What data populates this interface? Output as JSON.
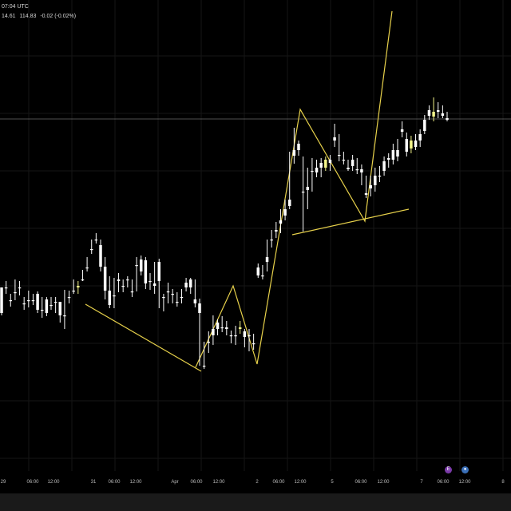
{
  "header": {
    "time_label": "07:04 UTC",
    "ohlc_fields": [
      "14.61",
      "114.83",
      "-0.02 (-0.02%)"
    ]
  },
  "badges": [
    {
      "name": "event-icon",
      "glyph": "E",
      "color": "#7a3aa8"
    },
    {
      "name": "flag-icon",
      "glyph": "●",
      "color": "#3a6fb8"
    }
  ],
  "colors": {
    "background": "#000000",
    "grid": "#161616",
    "candle_up": "#f3f58a",
    "candle_down": "#ffffff",
    "pattern_lines": "#e7d14b",
    "price_line": "#6c6c6c",
    "tick_text": "#bdbdbd"
  },
  "chart_data": {
    "type": "candlestick",
    "x_axis": {
      "tick_labels": [
        "29",
        "06:00",
        "12:00",
        "31",
        "06:00",
        "12:00",
        "Apr",
        "06:00",
        "12:00",
        "2",
        "06:00",
        "12:00",
        "5",
        "06:00",
        "12:00",
        "7",
        "06:00",
        "12:00",
        "8"
      ]
    },
    "grid": true,
    "price_line": 149,
    "candles": [
      [
        360,
        360,
        392,
        395
      ],
      [
        360,
        352,
        360,
        368
      ],
      [
        376,
        368,
        376,
        384
      ],
      [
        366,
        350,
        366,
        376
      ],
      [
        360,
        352,
        360,
        370
      ],
      [
        380,
        372,
        380,
        388
      ],
      [
        376,
        364,
        376,
        385
      ],
      [
        376,
        368,
        376,
        382
      ],
      [
        368,
        365,
        388,
        392
      ],
      [
        388,
        372,
        388,
        398
      ],
      [
        375,
        372,
        392,
        396
      ],
      [
        382,
        372,
        382,
        388
      ],
      [
        378,
        372,
        378,
        392
      ],
      [
        378,
        378,
        395,
        404
      ],
      [
        395,
        363,
        395,
        412
      ],
      [
        372,
        364,
        372,
        380
      ],
      [
        364,
        350,
        364,
        368
      ],
      [
        360,
        352,
        358,
        368
      ],
      [
        350,
        338,
        350,
        352
      ],
      [
        335,
        322,
        335,
        340
      ],
      [
        312,
        300,
        312,
        318
      ],
      [
        300,
        292,
        300,
        305
      ],
      [
        307,
        300,
        334,
        340
      ],
      [
        334,
        322,
        364,
        375
      ],
      [
        364,
        346,
        382,
        386
      ],
      [
        370,
        348,
        370,
        386
      ],
      [
        350,
        342,
        352,
        366
      ],
      [
        358,
        350,
        358,
        366
      ],
      [
        350,
        346,
        350,
        360
      ],
      [
        365,
        350,
        365,
        372
      ],
      [
        332,
        322,
        332,
        365
      ],
      [
        325,
        320,
        340,
        345
      ],
      [
        326,
        322,
        355,
        362
      ],
      [
        352,
        342,
        352,
        363
      ],
      [
        355,
        328,
        358,
        368
      ],
      [
        328,
        324,
        352,
        386
      ],
      [
        372,
        368,
        372,
        390
      ],
      [
        365,
        354,
        365,
        380
      ],
      [
        368,
        362,
        368,
        380
      ],
      [
        378,
        366,
        378,
        384
      ],
      [
        372,
        362,
        372,
        380
      ],
      [
        354,
        348,
        360,
        365
      ],
      [
        350,
        348,
        360,
        368
      ],
      [
        375,
        350,
        380,
        385
      ],
      [
        380,
        374,
        392,
        458
      ],
      [
        458,
        428,
        458,
        462
      ],
      [
        428,
        415,
        428,
        442
      ],
      [
        412,
        395,
        420,
        432
      ],
      [
        404,
        400,
        412,
        420
      ],
      [
        410,
        396,
        410,
        416
      ],
      [
        410,
        402,
        412,
        420
      ],
      [
        420,
        414,
        420,
        430
      ],
      [
        420,
        408,
        420,
        432
      ],
      [
        412,
        402,
        410,
        418
      ],
      [
        415,
        412,
        422,
        435
      ],
      [
        420,
        412,
        420,
        440
      ],
      [
        430,
        418,
        430,
        438
      ],
      [
        335,
        330,
        345,
        348
      ],
      [
        345,
        332,
        345,
        350
      ],
      [
        322,
        300,
        328,
        340
      ],
      [
        300,
        288,
        300,
        310
      ],
      [
        288,
        278,
        290,
        298
      ],
      [
        276,
        262,
        280,
        292
      ],
      [
        262,
        250,
        270,
        276
      ],
      [
        250,
        190,
        258,
        262
      ],
      [
        188,
        160,
        195,
        205
      ],
      [
        180,
        176,
        188,
        195
      ],
      [
        240,
        196,
        240,
        290
      ],
      [
        234,
        210,
        238,
        262
      ],
      [
        214,
        198,
        214,
        240
      ],
      [
        210,
        200,
        216,
        222
      ],
      [
        204,
        198,
        210,
        222
      ],
      [
        210,
        196,
        200,
        214
      ],
      [
        200,
        194,
        204,
        214
      ],
      [
        172,
        155,
        176,
        184
      ],
      [
        194,
        168,
        194,
        202
      ],
      [
        200,
        190,
        200,
        206
      ],
      [
        210,
        200,
        212,
        214
      ],
      [
        200,
        194,
        208,
        214
      ],
      [
        212,
        198,
        212,
        218
      ],
      [
        212,
        206,
        216,
        232
      ],
      [
        242,
        220,
        244,
        248
      ],
      [
        232,
        220,
        236,
        246
      ],
      [
        220,
        210,
        232,
        240
      ],
      [
        220,
        208,
        220,
        228
      ],
      [
        202,
        196,
        214,
        220
      ],
      [
        198,
        192,
        200,
        210
      ],
      [
        188,
        180,
        200,
        206
      ],
      [
        188,
        174,
        196,
        202
      ],
      [
        162,
        152,
        165,
        172
      ],
      [
        174,
        166,
        190,
        196
      ],
      [
        186,
        170,
        176,
        192
      ],
      [
        176,
        168,
        184,
        188
      ],
      [
        168,
        162,
        176,
        184
      ],
      [
        150,
        144,
        164,
        168
      ],
      [
        138,
        132,
        145,
        150
      ],
      [
        146,
        122,
        140,
        152
      ],
      [
        138,
        128,
        140,
        148
      ],
      [
        142,
        132,
        145,
        148
      ],
      [
        148,
        140,
        150,
        152
      ]
    ],
    "pattern_lines": [
      [
        [
          107,
          381
        ],
        [
          252,
          465
        ]
      ],
      [
        [
          245,
          460
        ],
        [
          292,
          358
        ],
        [
          322,
          456
        ],
        [
          376,
          137
        ],
        [
          457,
          277
        ],
        [
          491,
          14
        ]
      ],
      [
        [
          366,
          294
        ],
        [
          512,
          262
        ]
      ]
    ]
  }
}
